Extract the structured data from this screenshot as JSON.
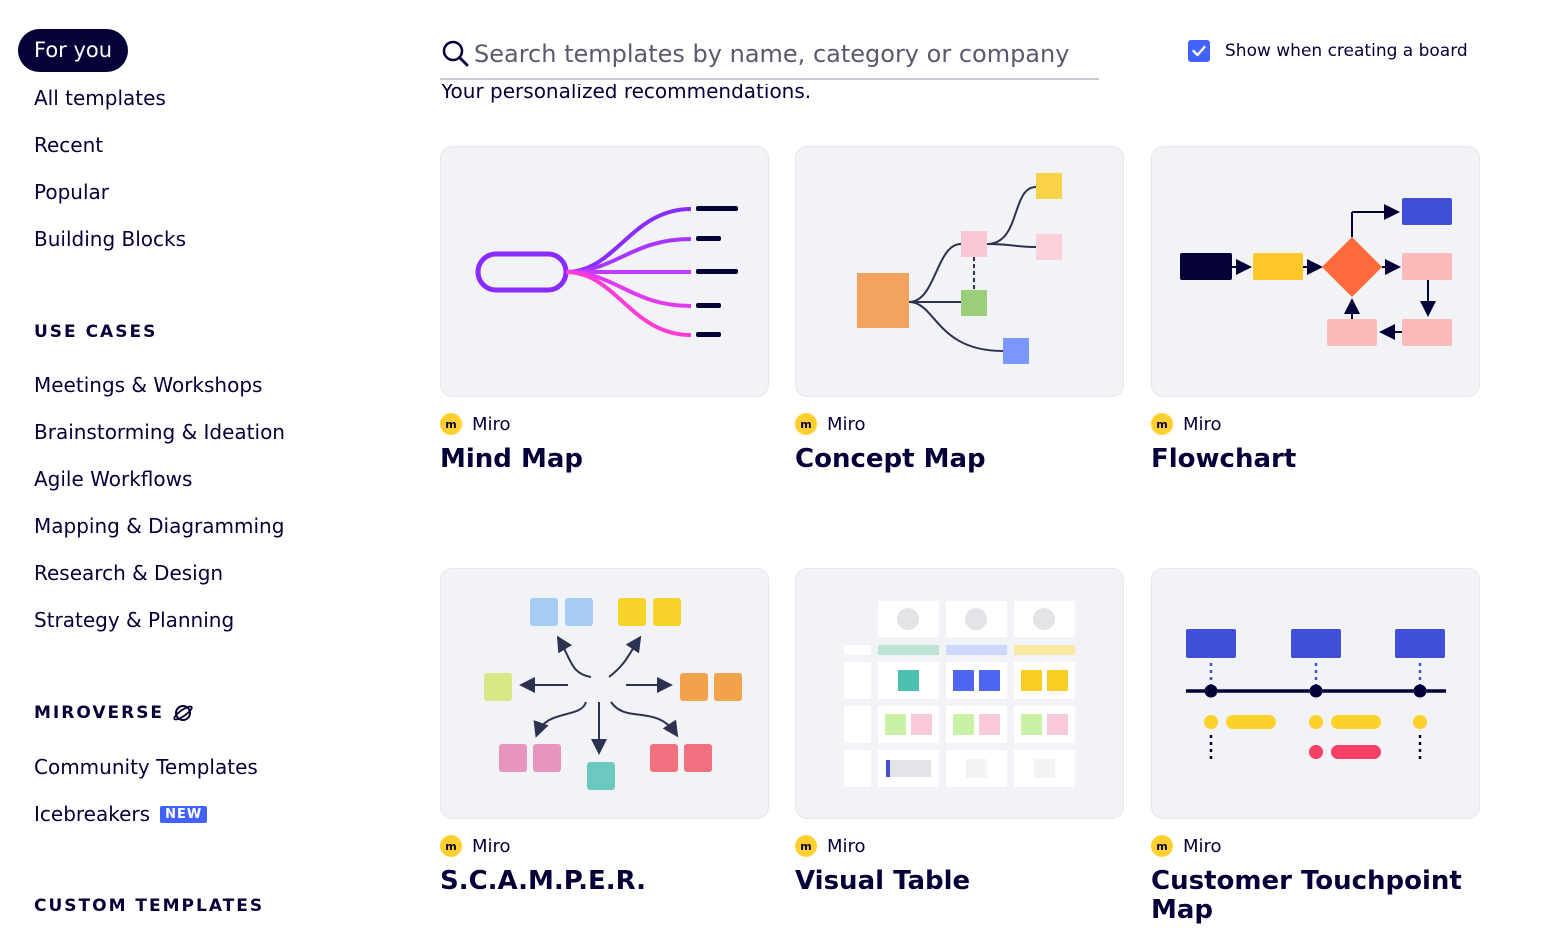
{
  "sidebar": {
    "active": "For you",
    "items": [
      "All templates",
      "Recent",
      "Popular",
      "Building Blocks"
    ],
    "use_cases_title": "USE CASES",
    "use_cases": [
      "Meetings & Workshops",
      "Brainstorming & Ideation",
      "Agile Workflows",
      "Mapping & Diagramming",
      "Research & Design",
      "Strategy & Planning"
    ],
    "miroverse_title": "MIROVERSE",
    "miroverse_items": [
      "Community Templates",
      "Icebreakers"
    ],
    "new_badge": "NEW",
    "custom_title": "CUSTOM TEMPLATES"
  },
  "search": {
    "placeholder": "Search templates by name, category or company"
  },
  "show_toggle": {
    "label": "Show when creating a board",
    "checked": true
  },
  "recommendations_text": "Your personalized recommendations.",
  "cards": [
    {
      "owner": "Miro",
      "title": "Mind Map"
    },
    {
      "owner": "Miro",
      "title": "Concept Map"
    },
    {
      "owner": "Miro",
      "title": "Flowchart"
    },
    {
      "owner": "Miro",
      "title": "S.C.A.M.P.E.R."
    },
    {
      "owner": "Miro",
      "title": "Visual Table"
    },
    {
      "owner": "Miro",
      "title": "Customer Touchpoint Map"
    }
  ],
  "colors": {
    "brand_dark": "#050038",
    "accent_blue": "#4262ff",
    "miro_yellow": "#ffd02f",
    "card_bg": "#f2f3f7"
  }
}
